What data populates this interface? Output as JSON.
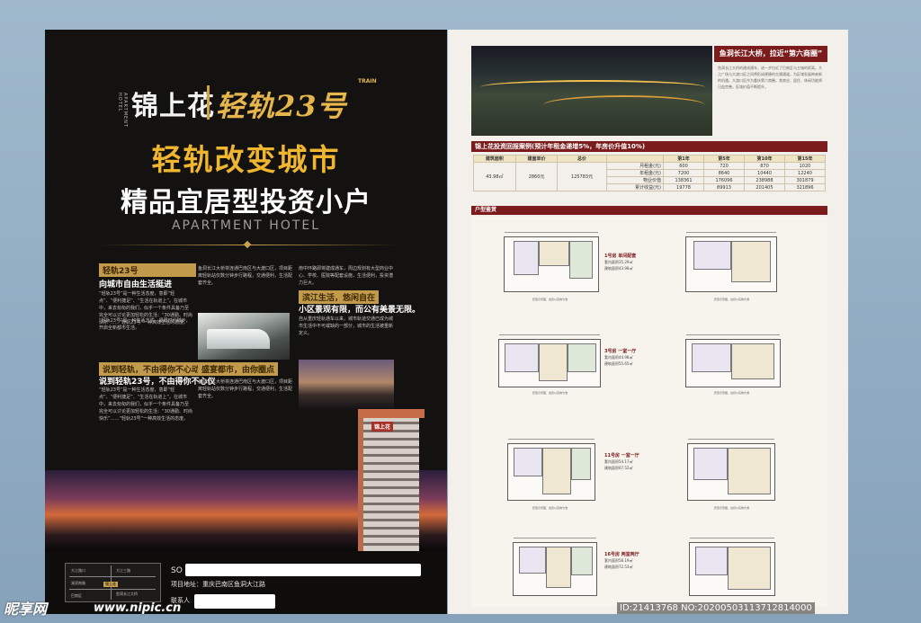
{
  "left": {
    "logo": {
      "brand": "锦上花",
      "hotel": "APARTMENT HOTEL",
      "line": "轻轨23号",
      "train": "TRAIN"
    },
    "headline1": "轻轨改变城市",
    "headline2": "精品宜居型投资小户",
    "headline3": "APARTMENT HOTEL",
    "sections": [
      {
        "tag": "轻轨23号",
        "subtitle": "向城市自由生活挺进"
      },
      {
        "tag": "说到轻轨，不由得你不心动",
        "subtitle": "说到轻轨23号，不由得你不心仪"
      },
      {
        "tag": "滨江生活，悠闲自在",
        "subtitle": "小区景观有限，而公有美景无限。"
      },
      {
        "tag": "盛宴都市，由你圈点",
        "subtitle": ""
      }
    ],
    "body": [
      "“轻轨23号”是一种生活态度，意即“轻点”、“便利捷足”、“生活在轨道上”。在城市中，来去匆匆的我们，似乎一个条件具备乃至完全可以讨论更加轻松的生活：“30通勤、时尚快乐”……“轻轨23号”一种高效生活的态度。",
      "“轻轨23号”是一种生活方式。紧跟时代脚步，开启全新都市生活。",
      "自从重庆轻轨通车以来，城市轨道交通已成为城市生活中不可或缺的一部分，城市的生活被重新定义。",
      "鱼洞长江大桥将连通巴南区与大渡口区，项目距离轻轨站仅数分钟步行路程，交通便利，生活配套齐全。",
      "南中环路即将建成通车，周边规划有大型商业中心、学校、医院等配套设施，生活便利，投资潜力巨大。"
    ],
    "building_name": "锦上花",
    "map": {
      "labels": [
        "大江路口",
        "大江三路",
        "渝滨南路",
        "鱼洞长江大桥",
        "巴南区"
      ],
      "mark": "锦上花"
    },
    "footer": {
      "line1": "SO",
      "line2": "项目地址：重庆巴南区鱼洞大江路",
      "line3": "联系人"
    }
  },
  "right": {
    "side_title": "鱼洞长江大桥，拉近“第六商圈”",
    "side_body": "鱼洞长江大桥的建成通车，进一步拉近了巴南区与主城的距离。大江广场与大渡口区之间将形成便捷的交通通道，为区域发展带来新的机遇。大渡口区作为重庆第六商圈，其商业、居住、休闲功能将日益完善，区域价值不断提升。",
    "invest_title": "锦上花投资回报案例(预计年租金递增5%，年房价升值10%)",
    "table": {
      "headers": [
        "建筑面积",
        "建面单价",
        "总价",
        "",
        "第1年",
        "第5年",
        "第10年",
        "第15年"
      ],
      "area": "43.98㎡",
      "unit_price": "2860元",
      "total": "125783元",
      "rows": [
        {
          "label": "月租金(元)",
          "values": [
            "600",
            "720",
            "870",
            "1020"
          ]
        },
        {
          "label": "年租金(元)",
          "values": [
            "7200",
            "8640",
            "10440",
            "12240"
          ]
        },
        {
          "label": "物业价值",
          "values": [
            "138361",
            "176096",
            "238988",
            "301879"
          ]
        },
        {
          "label": "累计收益(元)",
          "values": [
            "19778",
            "89913",
            "201405",
            "321896"
          ]
        }
      ]
    },
    "plans_title": "户型鉴赏",
    "units": [
      {
        "name": "1号房 单间配套",
        "spec1": "套内面积35.29㎡",
        "spec2": "建筑面积43.98㎡"
      },
      {
        "name": "3号房 一室一厅",
        "spec1": "套内面积44.98㎡",
        "spec2": "建筑面积55.65㎡"
      },
      {
        "name": "11号房 一室一厅",
        "spec1": "套内面积54.17㎡",
        "spec2": "建筑面积67.52㎡"
      },
      {
        "name": "16号房 两室两厅",
        "spec1": "套内面积58.19㎡",
        "spec2": "建筑面积72.53㎡"
      }
    ],
    "plan_caption": "套型示意图，最终以实物为准"
  },
  "watermark": {
    "logo": "昵享网",
    "url": "www.nipic.cn",
    "id": "ID:21413768 NO:20200503113712814000"
  }
}
